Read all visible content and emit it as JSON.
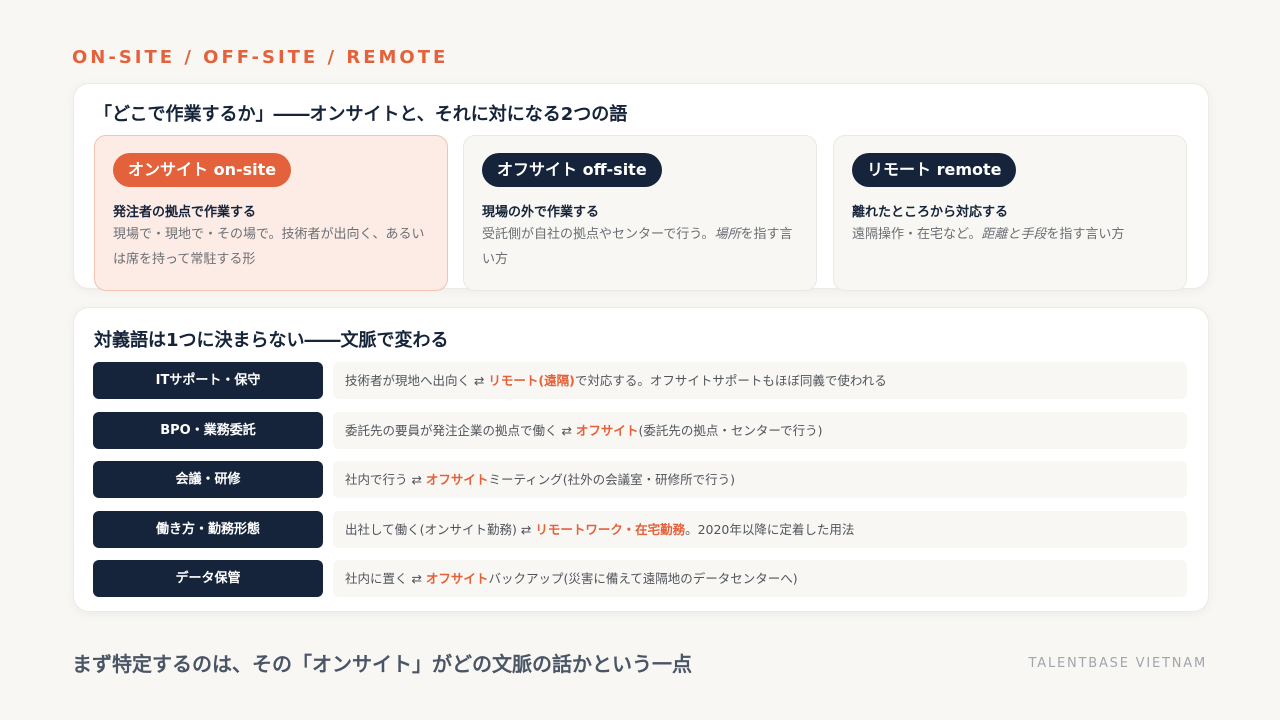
{
  "kicker": "ON-SITE / OFF-SITE / REMOTE",
  "section1": {
    "title": "「どこで作業するか」――オンサイトと、それに対になる2つの語",
    "terms": [
      {
        "label": "オンサイト on-site",
        "subtitle": "発注者の拠点で作業する",
        "description": "現場で・現地で・その場で。技術者が出向く、あるいは席を持って常駐する形",
        "highlighted": true
      },
      {
        "label": "オフサイト off-site",
        "subtitle": "現場の外で作業する",
        "description_before": "受託側が自社の拠点やセンターで行う。",
        "description_em": "場所",
        "description_after": "を指す言い方",
        "highlighted": false
      },
      {
        "label": "リモート remote",
        "subtitle": "離れたところから対応する",
        "description_before": "遠隔操作・在宅など。",
        "description_em": "距離と手段",
        "description_after": "を指す言い方",
        "highlighted": false
      }
    ]
  },
  "section2": {
    "title": "対義語は1つに決まらない――文脈で変わる",
    "rows": [
      {
        "context": "ITサポート・保守",
        "before": "技術者が現地へ出向く ⇄ ",
        "highlight": "リモート(遠隔)",
        "after": "で対応する。オフサイトサポートもほぼ同義で使われる"
      },
      {
        "context": "BPO・業務委託",
        "before": "委託先の要員が発注企業の拠点で働く ⇄ ",
        "highlight": "オフサイト",
        "after": "(委託先の拠点・センターで行う)"
      },
      {
        "context": "会議・研修",
        "before": "社内で行う ⇄ ",
        "highlight": "オフサイト",
        "after": "ミーティング(社外の会議室・研修所で行う)"
      },
      {
        "context": "働き方・勤務形態",
        "before": "出社して働く(オンサイト勤務) ⇄ ",
        "highlight": "リモートワーク・在宅勤務",
        "after": "。2020年以降に定着した用法"
      },
      {
        "context": "データ保管",
        "before": "社内に置く ⇄ ",
        "highlight": "オフサイト",
        "after": "バックアップ(災害に備えて遠隔地のデータセンターへ)"
      }
    ]
  },
  "footer": "まず特定するのは、その「オンサイト」がどの文脈の話かという一点",
  "brand": "TALENTBASE VIETNAM",
  "colors": {
    "accent": "#e3623b",
    "navy": "#15243b",
    "background": "#f8f7f4"
  }
}
